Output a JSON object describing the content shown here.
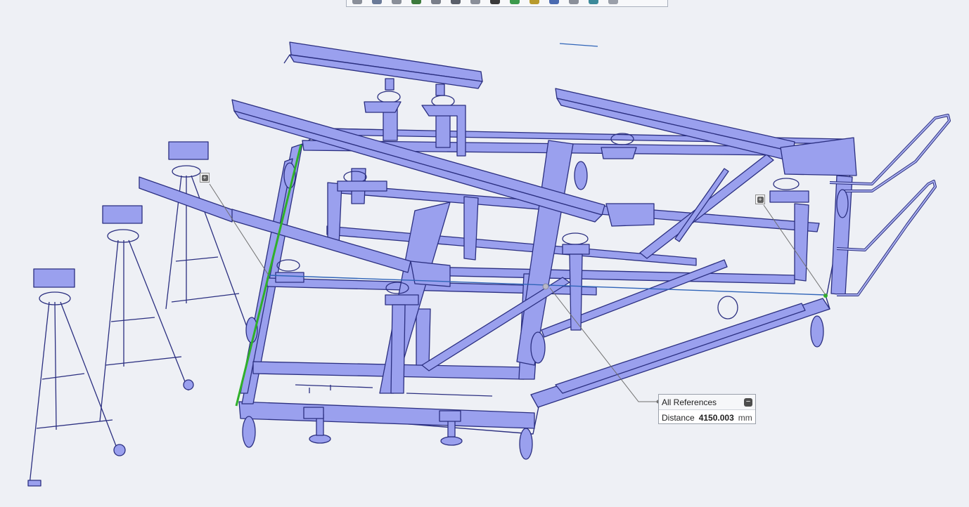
{
  "measure": {
    "title": "All References",
    "collapse_glyph": "−",
    "label": "Distance",
    "value": "4150.003",
    "unit": "mm"
  },
  "markers": {
    "glyph": "+"
  },
  "colors": {
    "background": "#eef0f5",
    "model_fill": "#9aa0ee",
    "model_edge": "#2b2f80",
    "selected_edge": "#2fb02a",
    "measure_line": "#2f64b8",
    "leader": "#707070"
  },
  "icons": [
    "toolbar-icon",
    "collapse-icon",
    "expand-icon"
  ]
}
